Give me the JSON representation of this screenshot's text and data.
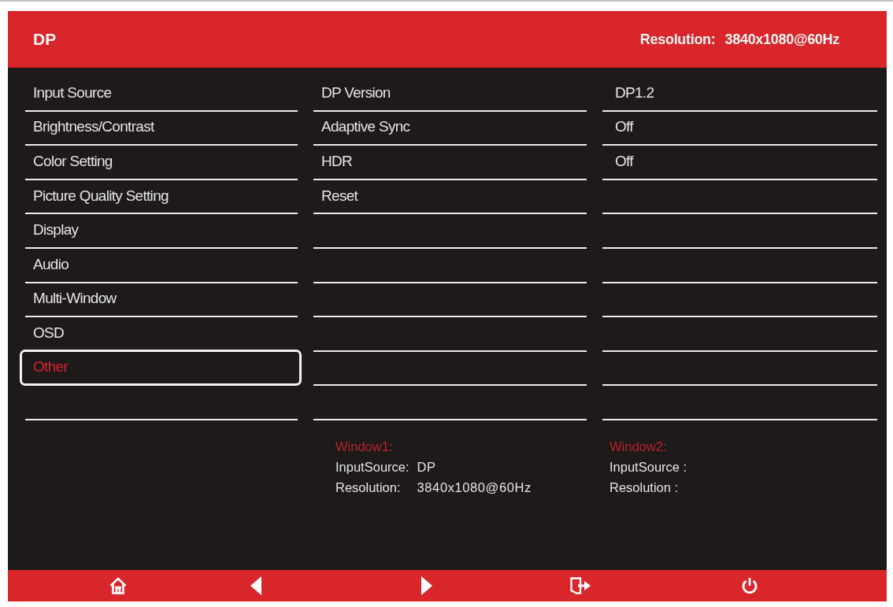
{
  "header": {
    "title": "DP",
    "resolution_label": "Resolution:",
    "resolution_value": "3840x1080@60Hz"
  },
  "menu": {
    "items": [
      {
        "label": "Input Source",
        "selected": false
      },
      {
        "label": "Brightness/Contrast",
        "selected": false
      },
      {
        "label": "Color Setting",
        "selected": false
      },
      {
        "label": "Picture Quality Setting",
        "selected": false
      },
      {
        "label": "Display",
        "selected": false
      },
      {
        "label": "Audio",
        "selected": false
      },
      {
        "label": "Multi-Window",
        "selected": false
      },
      {
        "label": "OSD",
        "selected": false
      },
      {
        "label": "Other",
        "selected": true
      }
    ]
  },
  "submenu": {
    "items": [
      "DP Version",
      "Adaptive Sync",
      "HDR",
      "Reset"
    ]
  },
  "values": {
    "items": [
      "DP1.2",
      "Off",
      "Off"
    ]
  },
  "windows": [
    {
      "title": "Window1:",
      "rows": [
        {
          "label": "InputSource:",
          "value": "DP"
        },
        {
          "label": "Resolution:",
          "value": "3840x1080@60Hz"
        }
      ]
    },
    {
      "title": "Window2:",
      "rows": [
        {
          "label": "InputSource :"
        },
        {
          "label": "Resolution :"
        }
      ]
    }
  ],
  "footer": {
    "buttons": [
      {
        "kind": "home"
      },
      {
        "kind": "left"
      },
      {
        "kind": "right"
      },
      {
        "kind": "exit"
      },
      {
        "kind": "power"
      }
    ]
  }
}
